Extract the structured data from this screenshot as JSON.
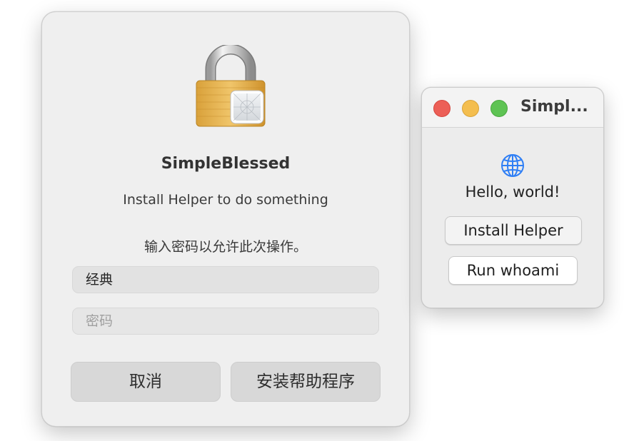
{
  "auth_dialog": {
    "app_name": "SimpleBlessed",
    "message": "Install Helper to do something",
    "prompt": "输入密码以允许此次操作。",
    "username_value": "经典",
    "password_placeholder": "密码",
    "cancel_label": "取消",
    "install_label": "安装帮助程序",
    "icon": "lock-icon"
  },
  "app_window": {
    "title": "Simpl...",
    "hello_text": "Hello, world!",
    "install_helper_label": "Install Helper",
    "run_whoami_label": "Run whoami",
    "icon": "globe-icon",
    "accent": "#2f7ff5"
  }
}
